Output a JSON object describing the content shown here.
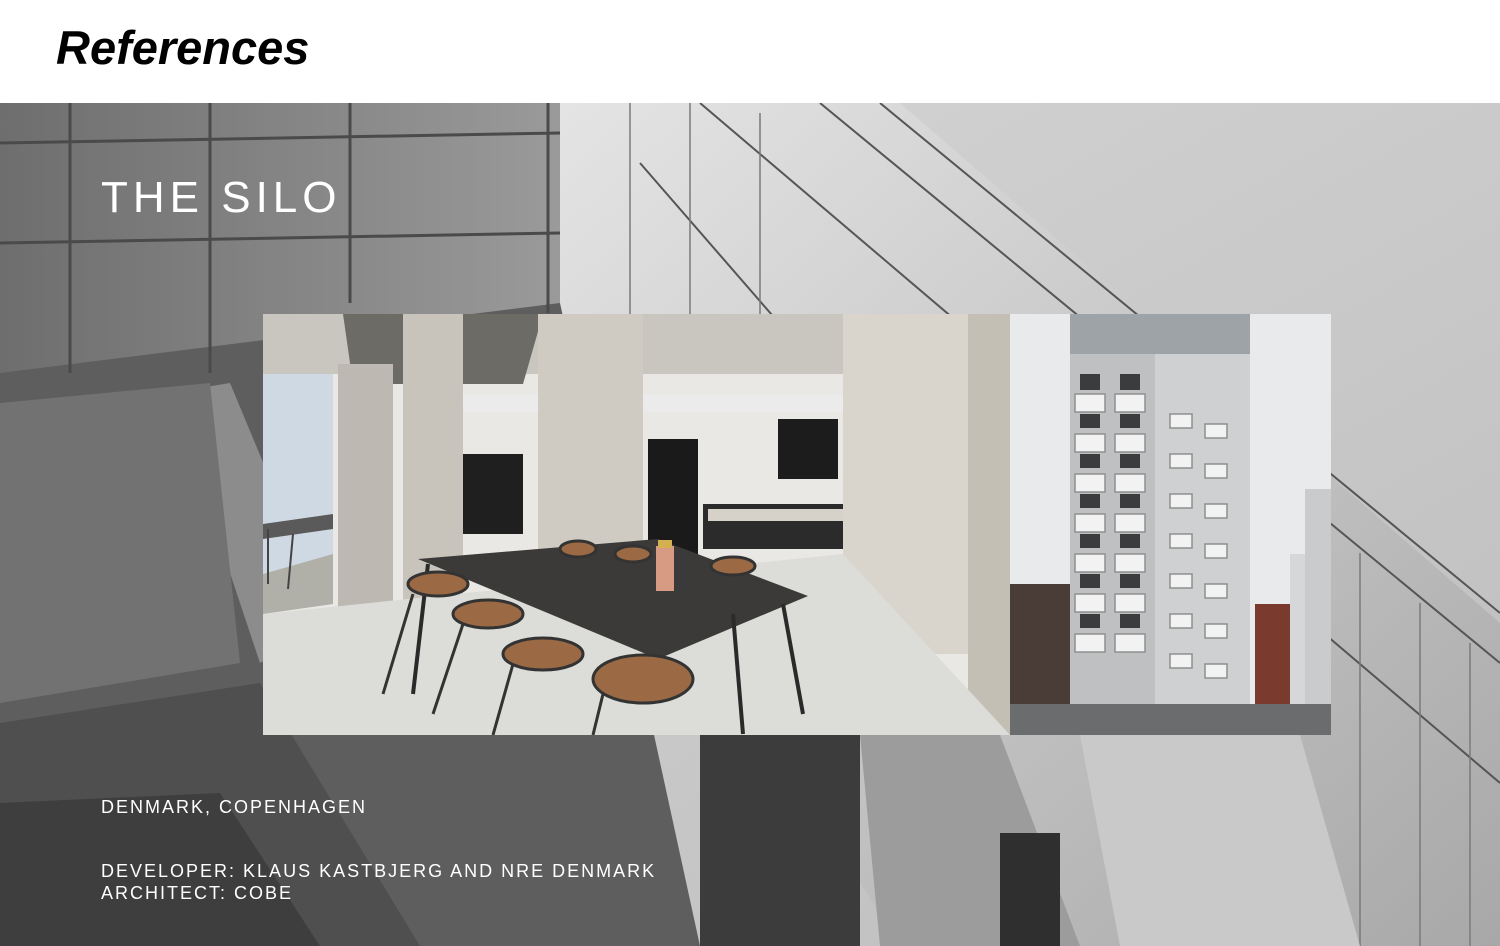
{
  "header": {
    "title": "References"
  },
  "project": {
    "title": "THE SILO",
    "location": "DENMARK, COPENHAGEN",
    "developer": "DEVELOPER: KLAUS KASTBJERG AND NRE DENMARK",
    "architect": "ARCHITECT: COBE"
  },
  "gallery": {
    "images": [
      {
        "name": "interior-photo"
      },
      {
        "name": "exterior-photo"
      }
    ]
  },
  "colors": {
    "background": "#ffffff",
    "heading": "#000000",
    "hero_text": "#ffffff"
  }
}
